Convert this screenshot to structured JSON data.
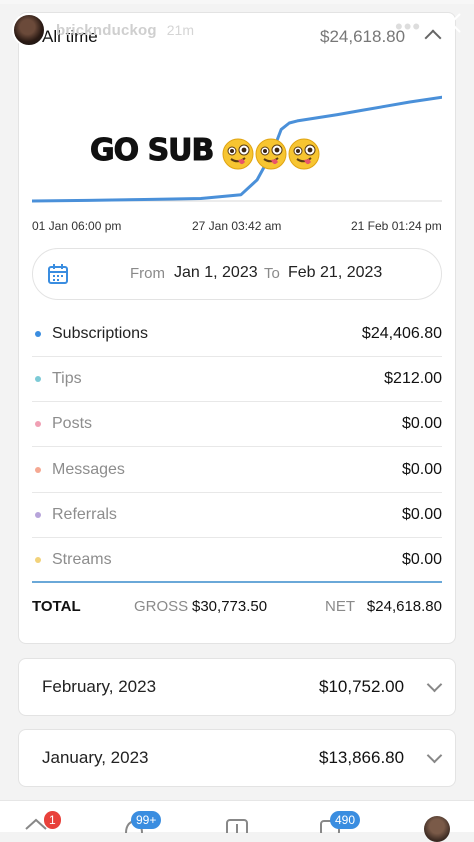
{
  "story": {
    "username": "bricknduckog",
    "time_ago": "21m",
    "menu_icon": "more-dots-icon",
    "close_icon": "close-icon"
  },
  "summary": {
    "label": "All time",
    "total": "$24,618.80"
  },
  "chart_data": {
    "type": "line",
    "title": "",
    "x_ticks": [
      "01 Jan 06:00 pm",
      "27 Jan 03:42 am",
      "21 Feb 01:24 pm"
    ],
    "x": [
      "2023-01-01",
      "2023-01-08",
      "2023-01-15",
      "2023-01-22",
      "2023-01-27",
      "2023-01-29",
      "2023-01-31",
      "2023-02-01",
      "2023-02-02",
      "2023-02-03",
      "2023-02-05",
      "2023-02-08",
      "2023-02-11",
      "2023-02-14",
      "2023-02-17",
      "2023-02-21"
    ],
    "series": [
      {
        "values": [
          0,
          150,
          350,
          600,
          1500,
          5000,
          12000,
          17000,
          18500,
          19000,
          19600,
          20500,
          21500,
          22500,
          23500,
          24618.8
        ],
        "color": "#4a90d9"
      }
    ],
    "ylim": [
      0,
      28000
    ],
    "grid": false
  },
  "overlay": {
    "sticker_text": "GO SUB",
    "emoji_name": "winking-face-with-tongue-emoji",
    "emoji_count": 3
  },
  "date_range": {
    "from_label": "From",
    "from_value": "Jan 1, 2023",
    "to_label": "To",
    "to_value": "Feb 21, 2023",
    "icon": "calendar-icon"
  },
  "breakdown": [
    {
      "label": "Subscriptions",
      "amount": "$24,406.80",
      "color": "#3a8de0"
    },
    {
      "label": "Tips",
      "amount": "$212.00",
      "color": "#7ccad6"
    },
    {
      "label": "Posts",
      "amount": "$0.00",
      "color": "#f0a0b4"
    },
    {
      "label": "Messages",
      "amount": "$0.00",
      "color": "#f5a892"
    },
    {
      "label": "Referrals",
      "amount": "$0.00",
      "color": "#b7a4da"
    },
    {
      "label": "Streams",
      "amount": "$0.00",
      "color": "#f2d27a"
    }
  ],
  "totals": {
    "label": "TOTAL",
    "gross_label": "GROSS",
    "gross_value": "$30,773.50",
    "net_label": "NET",
    "net_value": "$24,618.80"
  },
  "months": [
    {
      "name": "February, 2023",
      "amount": "$10,752.00"
    },
    {
      "name": "January, 2023",
      "amount": "$13,866.80"
    }
  ],
  "bottom_nav": {
    "home_badge": "1",
    "notifications_badge": "99+",
    "messages_badge": "490"
  }
}
